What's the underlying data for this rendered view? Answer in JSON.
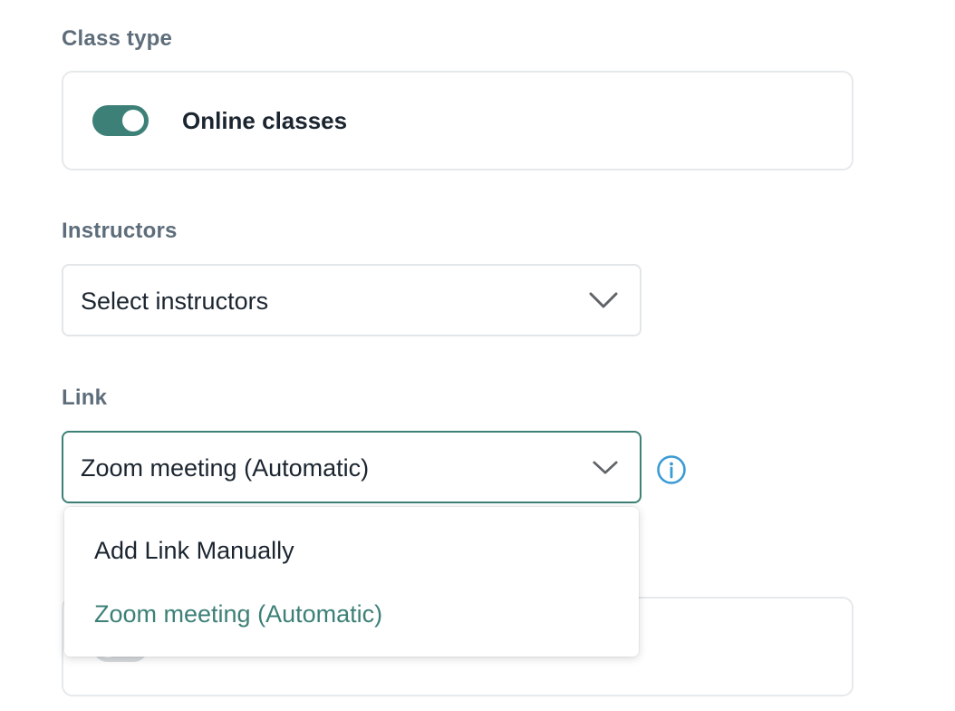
{
  "class_type": {
    "label": "Class type",
    "toggle_label": "Online classes",
    "toggle_on": true
  },
  "instructors": {
    "label": "Instructors",
    "value": "Select instructors"
  },
  "link": {
    "label": "Link",
    "value": "Zoom meeting (Automatic)",
    "options": [
      "Add Link Manually",
      "Zoom meeting (Automatic)"
    ]
  },
  "colors": {
    "accent": "#3d8077",
    "info": "#3a9bd5",
    "label": "#5d6d7a"
  },
  "icons": [
    "chevron-down-icon",
    "info-icon"
  ]
}
